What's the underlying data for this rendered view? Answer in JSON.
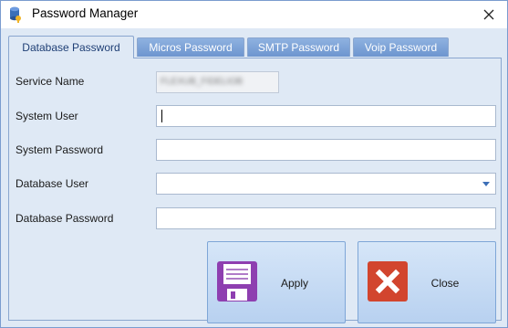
{
  "window": {
    "title": "Password Manager"
  },
  "tabs": [
    {
      "label": "Database Password"
    },
    {
      "label": "Micros Password"
    },
    {
      "label": "SMTP Password"
    },
    {
      "label": "Voip Password"
    }
  ],
  "form": {
    "service_name": {
      "label": "Service Name",
      "value": "FLEXUB_FIDELIOB"
    },
    "system_user": {
      "label": "System User",
      "value": ""
    },
    "system_password": {
      "label": "System Password",
      "value": ""
    },
    "database_user": {
      "label": "Database User",
      "value": ""
    },
    "database_password": {
      "label": "Database Password",
      "value": ""
    }
  },
  "buttons": {
    "apply": {
      "label": "Apply",
      "icon": "floppy-disk-icon"
    },
    "close": {
      "label": "Close",
      "icon": "close-x-icon"
    }
  },
  "colors": {
    "tab_inactive": "#6d95cf",
    "panel_bg": "#dfe9f5",
    "apply_icon": "#8e3fb0",
    "close_icon": "#d2452e"
  }
}
